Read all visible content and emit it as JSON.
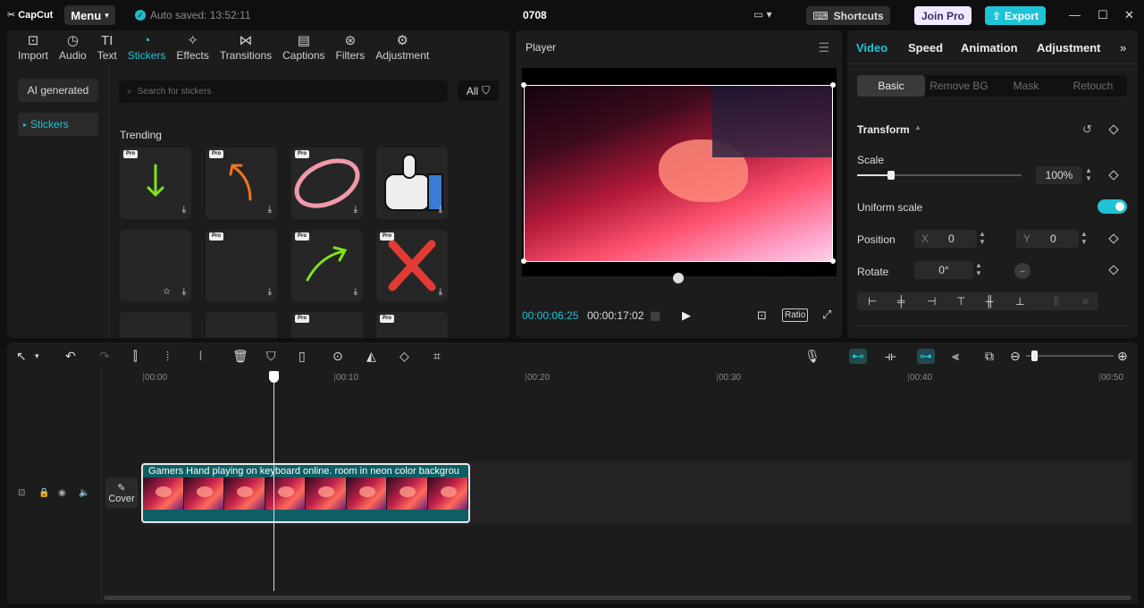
{
  "titlebar": {
    "logo": "CapCut",
    "menu": "Menu",
    "autosave": "Auto saved: 13:52:11",
    "project": "0708",
    "shortcuts": "Shortcuts",
    "join_pro": "Join Pro",
    "export": "Export"
  },
  "left_tabs": [
    {
      "label": "Import",
      "icon": "import-icon"
    },
    {
      "label": "Audio",
      "icon": "audio-icon"
    },
    {
      "label": "Text",
      "icon": "text-icon"
    },
    {
      "label": "Stickers",
      "icon": "stickers-icon"
    },
    {
      "label": "Effects",
      "icon": "effects-icon"
    },
    {
      "label": "Transitions",
      "icon": "transitions-icon"
    },
    {
      "label": "Captions",
      "icon": "captions-icon"
    },
    {
      "label": "Filters",
      "icon": "filters-icon"
    },
    {
      "label": "Adjustment",
      "icon": "adjustment-icon"
    }
  ],
  "sidebar": {
    "ai": "AI generated",
    "stickers": "Stickers"
  },
  "search": {
    "placeholder": "Search for stickers"
  },
  "filter": {
    "label": "All"
  },
  "section": {
    "trending": "Trending"
  },
  "pro_badge": "Pro",
  "player": {
    "title": "Player",
    "current": "00:00:06:25",
    "total": "00:00:17:02",
    "ratio": "Ratio"
  },
  "right_tabs": [
    "Video",
    "Speed",
    "Animation",
    "Adjustment"
  ],
  "sub_tabs": [
    "Basic",
    "Remove BG",
    "Mask",
    "Retouch"
  ],
  "transform": {
    "title": "Transform",
    "scale_label": "Scale",
    "scale_value": "100%",
    "uniform": "Uniform scale",
    "position": "Position",
    "x_label": "X",
    "x_value": "0",
    "y_label": "Y",
    "y_value": "0",
    "rotate": "Rotate",
    "rotate_value": "0°"
  },
  "timeline": {
    "ruler": [
      "00:00",
      "00:10",
      "00:20",
      "00:30",
      "00:40",
      "00:50"
    ],
    "clip_title": "Gamers Hand playing on keyboard online. room  in neon color backgrou",
    "cover": "Cover"
  }
}
